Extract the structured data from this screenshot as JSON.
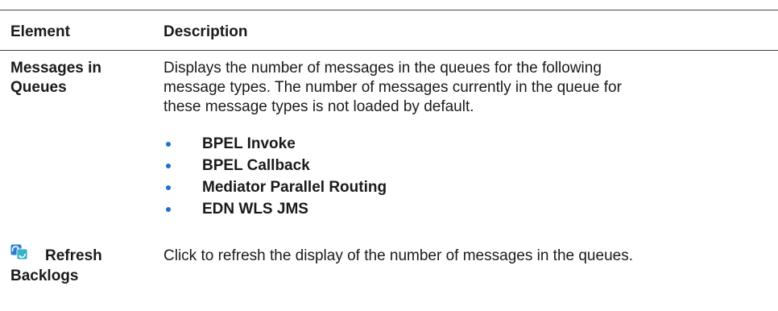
{
  "table": {
    "headers": {
      "element": "Element",
      "description": "Description"
    },
    "rows": [
      {
        "element_line1": "Messages in",
        "element_line2": "Queues",
        "description_lines": [
          "Displays the number of messages in the queues for the following",
          "message types. The number of messages currently in the queue for",
          "these message types is not loaded by default."
        ],
        "bullets": [
          "BPEL Invoke",
          "BPEL Callback",
          "Mediator Parallel Routing",
          "EDN WLS JMS"
        ]
      },
      {
        "icon": "refresh-icon",
        "element_line1": "Refresh",
        "element_line2": "Backlogs",
        "description": "Click to refresh the display of the number of messages in the queues."
      }
    ]
  },
  "colors": {
    "bullet": "#1e6fd0",
    "rule": "#444444",
    "icon_blue": "#2a7fd4",
    "icon_teal": "#37b2c8"
  }
}
